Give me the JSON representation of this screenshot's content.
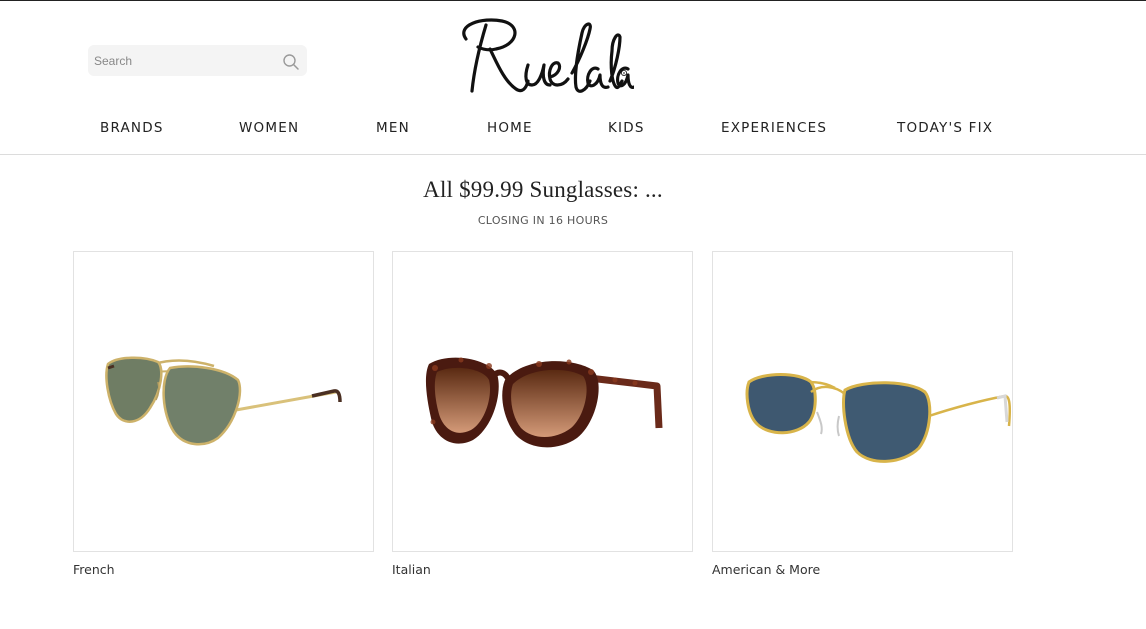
{
  "header": {
    "search": {
      "placeholder": "Search",
      "value": "",
      "icon": "search-icon"
    },
    "logo_text": "Rue La La"
  },
  "nav": {
    "items": [
      {
        "label": "BRANDS"
      },
      {
        "label": "WOMEN"
      },
      {
        "label": "MEN"
      },
      {
        "label": "HOME"
      },
      {
        "label": "KIDS"
      },
      {
        "label": "EXPERIENCES"
      },
      {
        "label": "TODAY'S FIX"
      }
    ]
  },
  "main": {
    "title": "All $99.99 Sunglasses: ...",
    "countdown": "CLOSING IN 16 HOURS",
    "products": [
      {
        "caption": "French",
        "image": "aviator-sunglasses-gold-green"
      },
      {
        "caption": "Italian",
        "image": "cat-eye-sunglasses-tortoise-brown"
      },
      {
        "caption": "American & More",
        "image": "square-sunglasses-gold-blue"
      }
    ]
  },
  "colors": {
    "text": "#222222",
    "search_bg": "#f4f4f4",
    "divider": "#dcdcdc",
    "card_border": "#e2e2e2"
  }
}
